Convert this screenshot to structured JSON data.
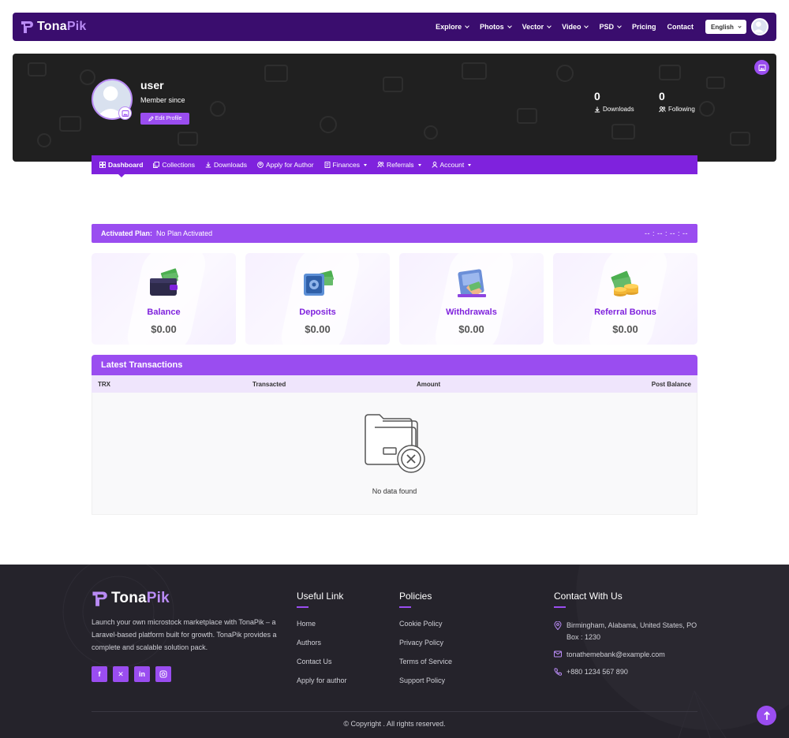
{
  "brand": {
    "name_part1": "Tona",
    "name_part2": "Pik"
  },
  "navbar": {
    "items": [
      {
        "label": "Explore",
        "dropdown": true
      },
      {
        "label": "Photos",
        "dropdown": true
      },
      {
        "label": "Vector",
        "dropdown": true
      },
      {
        "label": "Video",
        "dropdown": true
      },
      {
        "label": "PSD",
        "dropdown": true
      },
      {
        "label": "Pricing",
        "dropdown": false
      },
      {
        "label": "Contact",
        "dropdown": false
      }
    ],
    "language": "English"
  },
  "profile": {
    "username": "user",
    "member_since": "Member since",
    "edit_label": "Edit Profile",
    "stats": [
      {
        "value": "0",
        "label": "Downloads",
        "icon": "download-icon"
      },
      {
        "value": "0",
        "label": "Following",
        "icon": "users-icon"
      }
    ]
  },
  "dashboard_nav": [
    {
      "label": "Dashboard",
      "icon": "dashboard-icon",
      "dropdown": false
    },
    {
      "label": "Collections",
      "icon": "collections-icon",
      "dropdown": false
    },
    {
      "label": "Downloads",
      "icon": "download-icon",
      "dropdown": false
    },
    {
      "label": "Apply for Author",
      "icon": "author-icon",
      "dropdown": false
    },
    {
      "label": "Finances",
      "icon": "finances-icon",
      "dropdown": true
    },
    {
      "label": "Referrals",
      "icon": "referrals-icon",
      "dropdown": true
    },
    {
      "label": "Account",
      "icon": "account-icon",
      "dropdown": true
    }
  ],
  "plan": {
    "label": "Activated Plan:",
    "value": "No Plan Activated",
    "timer": "-- : -- : -- : --"
  },
  "cards": [
    {
      "title": "Balance",
      "amount": "$0.00",
      "icon": "wallet-icon"
    },
    {
      "title": "Deposits",
      "amount": "$0.00",
      "icon": "safe-icon"
    },
    {
      "title": "Withdrawals",
      "amount": "$0.00",
      "icon": "atm-icon"
    },
    {
      "title": "Referral Bonus",
      "amount": "$0.00",
      "icon": "coins-icon"
    }
  ],
  "transactions": {
    "title": "Latest Transactions",
    "columns": [
      "TRX",
      "Transacted",
      "Amount",
      "Post Balance"
    ],
    "empty_text": "No data found"
  },
  "footer": {
    "description": "Launch your own microstock marketplace with TonaPik – a Laravel-based platform built for growth. TonaPik provides a complete and scalable solution pack.",
    "socials": [
      "facebook-icon",
      "x-icon",
      "linkedin-icon",
      "instagram-icon"
    ],
    "useful_title": "Useful Link",
    "useful_links": [
      "Home",
      "Authors",
      "Contact Us",
      "Apply for author"
    ],
    "policies_title": "Policies",
    "policies_links": [
      "Cookie Policy",
      "Privacy Policy",
      "Terms of Service",
      "Support Policy"
    ],
    "contact_title": "Contact With Us",
    "address": "Birmingham, Alabama, United States, PO Box : 1230",
    "email": "tonathemebank@example.com",
    "phone": "+880 1234 567 890",
    "copyright": "© Copyright . All rights reserved."
  },
  "colors": {
    "primary": "#9a4df0",
    "navbar": "#3a0d6e",
    "hero": "#202020",
    "footer": "#25232b"
  }
}
